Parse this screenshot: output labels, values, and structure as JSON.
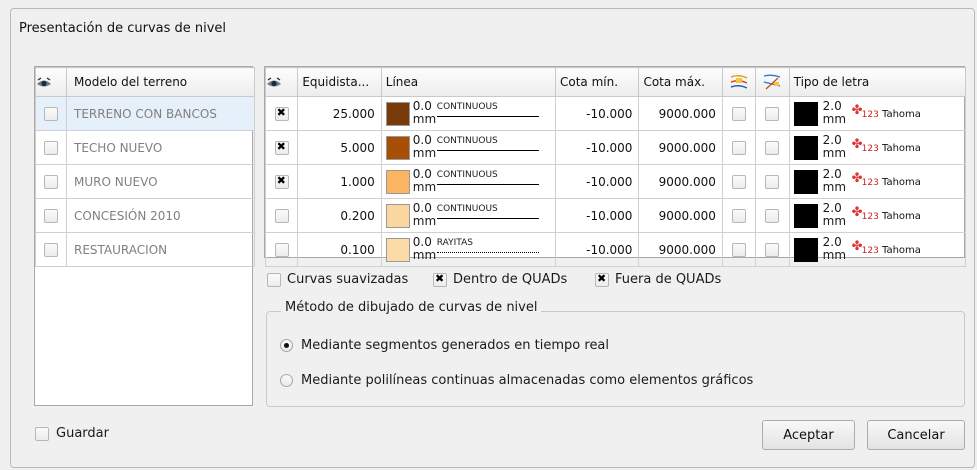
{
  "window": {
    "title": "Presentación de curvas de nivel"
  },
  "terrain": {
    "header": "Modelo del terreno",
    "rows": [
      {
        "name": "TERRENO CON BANCOS",
        "selected": true
      },
      {
        "name": "TECHO NUEVO"
      },
      {
        "name": "MURO NUEVO"
      },
      {
        "name": "CONCESIÓN 2010"
      },
      {
        "name": "RESTAURACION"
      }
    ]
  },
  "contours": {
    "headers": {
      "equidistance": "Equidista...",
      "line": "Línea",
      "min": "Cota mín.",
      "max": "Cota máx.",
      "font": "Tipo de letra"
    },
    "rows": [
      {
        "checked": true,
        "equidistance": "25.000",
        "color": "#7a3b0b",
        "width": "0.0",
        "unit": "mm",
        "linetype": "CONTINUOUS",
        "min": "-10.000",
        "max": "9000.000",
        "font_size": "2.0",
        "font_unit": "mm",
        "font_name": "Tahoma"
      },
      {
        "checked": true,
        "equidistance": "5.000",
        "color": "#a64f05",
        "width": "0.0",
        "unit": "mm",
        "linetype": "CONTINUOUS",
        "min": "-10.000",
        "max": "9000.000",
        "font_size": "2.0",
        "font_unit": "mm",
        "font_name": "Tahoma"
      },
      {
        "checked": true,
        "equidistance": "1.000",
        "color": "#fbb45f",
        "width": "0.0",
        "unit": "mm",
        "linetype": "CONTINUOUS",
        "min": "-10.000",
        "max": "9000.000",
        "font_size": "2.0",
        "font_unit": "mm",
        "font_name": "Tahoma"
      },
      {
        "checked": false,
        "equidistance": "0.200",
        "color": "#fbd79f",
        "width": "0.0",
        "unit": "mm",
        "linetype": "CONTINUOUS",
        "min": "-10.000",
        "max": "9000.000",
        "font_size": "2.0",
        "font_unit": "mm",
        "font_name": "Tahoma"
      },
      {
        "checked": false,
        "equidistance": "0.100",
        "color": "#fbdca8",
        "width": "0.0",
        "unit": "mm",
        "linetype": "RAYITAS",
        "min": "-10.000",
        "max": "9000.000",
        "font_size": "2.0",
        "font_unit": "mm",
        "font_name": "Tahoma"
      }
    ],
    "font_icon": "123"
  },
  "options": {
    "smooth": {
      "label": "Curvas suavizadas",
      "checked": false
    },
    "inside": {
      "label": "Dentro de QUADs",
      "checked": true
    },
    "outside": {
      "label": "Fuera de QUADs",
      "checked": true
    }
  },
  "method": {
    "legend": "Método de dibujado de curvas de nivel",
    "realtime": {
      "label": "Mediante segmentos generados en tiempo real",
      "checked": true
    },
    "polylines": {
      "label": "Mediante polilíneas continuas almacenadas como elementos gráficos",
      "checked": false
    }
  },
  "footer": {
    "save_label": "Guardar",
    "accept_label": "Aceptar",
    "cancel_label": "Cancelar"
  }
}
